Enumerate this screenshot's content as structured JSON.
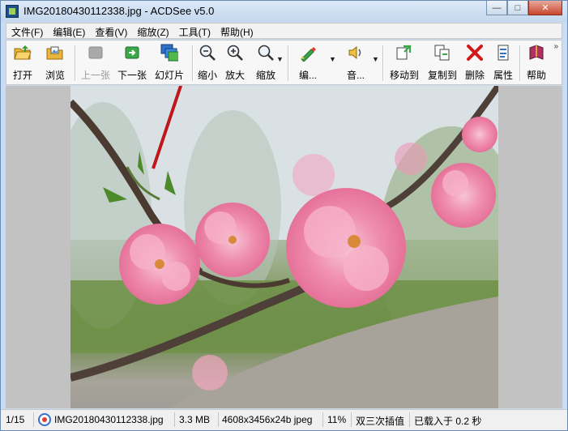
{
  "window": {
    "title": "IMG20180430112338.jpg - ACDSee v5.0",
    "minimize": "—",
    "maximize": "□",
    "close": "✕"
  },
  "menu": [
    "文件(F)",
    "编辑(E)",
    "查看(V)",
    "缩放(Z)",
    "工具(T)",
    "帮助(H)"
  ],
  "toolbar": {
    "open": "打开",
    "browse": "浏览",
    "prev": "上一张",
    "next": "下一张",
    "slideshow": "幻灯片",
    "zoom_out": "缩小",
    "zoom_in": "放大",
    "zoom": "缩放",
    "edit": "编...",
    "audio": "音...",
    "move_to": "移动到",
    "copy_to": "复制到",
    "delete": "删除",
    "properties": "属性",
    "help": "帮助",
    "more": "»"
  },
  "annotation": {
    "arrow_color": "#c0161d"
  },
  "status": {
    "index": "1/15",
    "filename": "IMG20180430112338.jpg",
    "size": "3.3 MB",
    "dimensions": "4608x3456x24b jpeg",
    "zoom": "11%",
    "resample": "双三次插值",
    "load_time": "已载入于 0.2 秒"
  }
}
